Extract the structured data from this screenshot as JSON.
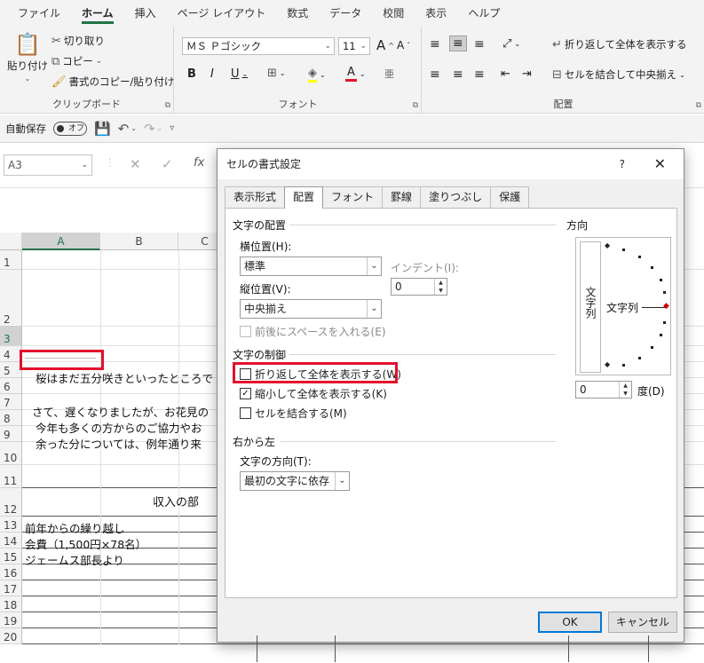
{
  "ribbon_tabs": [
    "ファイル",
    "ホーム",
    "挿入",
    "ページ レイアウト",
    "数式",
    "データ",
    "校閲",
    "表示",
    "ヘルプ"
  ],
  "clipboard": {
    "paste": "貼り付け",
    "cut": "切り取り",
    "copy": "コピー",
    "format_painter": "書式のコピー/貼り付け",
    "label": "クリップボード"
  },
  "font": {
    "name": "ＭＳ Ｐゴシック",
    "size": "11",
    "grow": "A",
    "shrink": "A",
    "bold": "B",
    "italic": "I",
    "underline": "U",
    "color_letter": "A",
    "phonetic": "亜",
    "label": "フォント"
  },
  "alignment": {
    "wrap_text": "折り返して全体を表示する",
    "merge_center": "セルを結合して中央揃え",
    "label": "配置"
  },
  "qat": {
    "autosave": "自動保存",
    "autosave_state": "オフ"
  },
  "formula_bar": {
    "name_box": "A3",
    "fx": "fx"
  },
  "grid": {
    "columns": [
      "A",
      "B",
      "C"
    ],
    "rows": [
      "1",
      "2",
      "3",
      "4",
      "5",
      "6",
      "7",
      "8",
      "9",
      "10",
      "11",
      "12",
      "13",
      "14",
      "15",
      "16",
      "17",
      "18",
      "19",
      "20"
    ],
    "cells": {
      "r4": "桜はまだ五分咲きといったところで",
      "r6": "さて、遅くなりましたが、お花見の",
      "r7": "今年も多くの方からのご協力やお",
      "r8": "余った分については、例年通り来",
      "r11": "収入の部",
      "r12": "前年からの繰り越し",
      "r13": "会費（1,500円×78名）",
      "r14": "ジェームス部長より"
    }
  },
  "dialog": {
    "title": "セルの書式設定",
    "help": "?",
    "close": "✕",
    "tabs": [
      "表示形式",
      "配置",
      "フォント",
      "罫線",
      "塗りつぶし",
      "保護"
    ],
    "active_tab": "配置",
    "text_alignment": {
      "section": "文字の配置",
      "horizontal_label": "横位置(H):",
      "horizontal_value": "標準",
      "indent_label": "インデント(I):",
      "indent_value": "0",
      "vertical_label": "縦位置(V):",
      "vertical_value": "中央揃え",
      "justify_distributed": "前後にスペースを入れる(E)"
    },
    "text_control": {
      "section": "文字の制御",
      "wrap_text": "折り返して全体を表示する(W)",
      "wrap_text_checked": false,
      "shrink_to_fit": "縮小して全体を表示する(K)",
      "shrink_to_fit_checked": true,
      "merge_cells": "セルを結合する(M)",
      "merge_cells_checked": false
    },
    "rtl": {
      "section": "右から左",
      "direction_label": "文字の方向(T):",
      "direction_value": "最初の文字に依存"
    },
    "orientation": {
      "section": "方向",
      "vertical_text": "文字列",
      "horizontal_text": "文字列",
      "degrees_value": "0",
      "degrees_label": "度(D)"
    },
    "ok": "OK",
    "cancel": "キャンセル"
  },
  "colors": {
    "accent": "#217346",
    "highlight": "#e3112d",
    "primary_button_border": "#0078d7"
  }
}
